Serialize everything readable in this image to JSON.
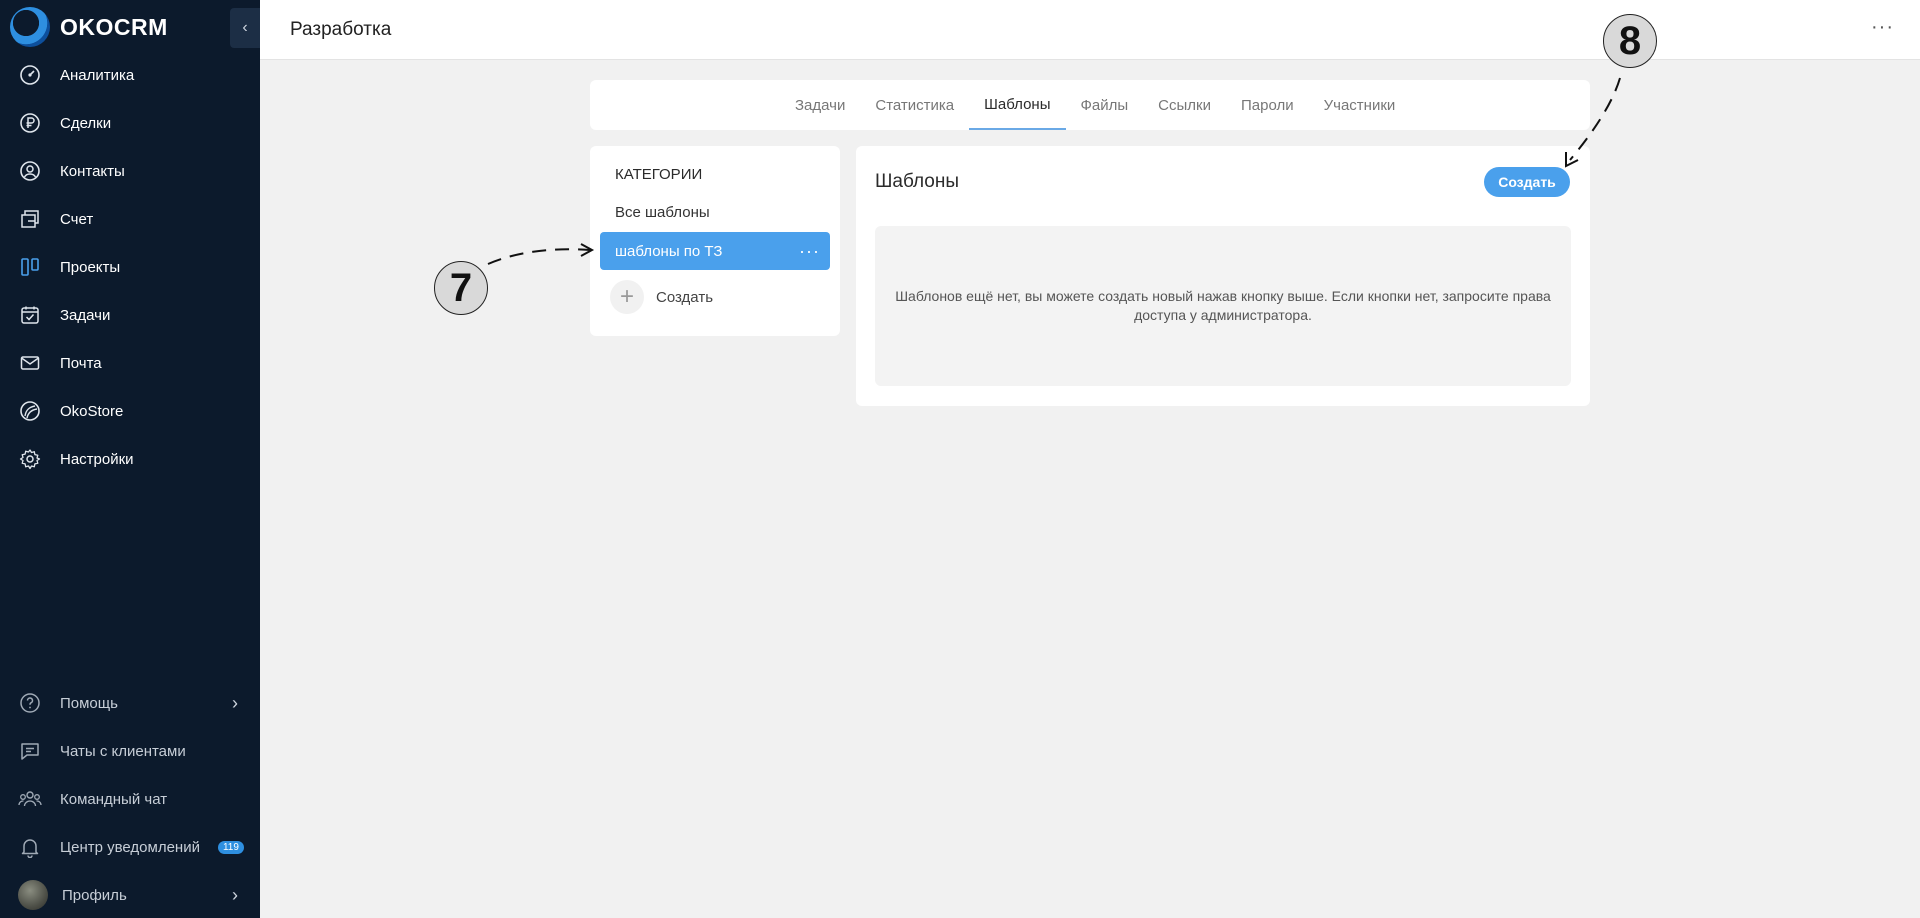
{
  "app": {
    "name": "OKOCRM"
  },
  "sidebar": {
    "items": [
      {
        "label": "Аналитика",
        "icon": "analytics-icon"
      },
      {
        "label": "Сделки",
        "icon": "ruble-icon"
      },
      {
        "label": "Контакты",
        "icon": "contact-icon"
      },
      {
        "label": "Счет",
        "icon": "invoice-icon"
      },
      {
        "label": "Проекты",
        "icon": "projects-icon"
      },
      {
        "label": "Задачи",
        "icon": "tasks-icon"
      },
      {
        "label": "Почта",
        "icon": "mail-icon"
      },
      {
        "label": "OkoStore",
        "icon": "store-icon"
      },
      {
        "label": "Настройки",
        "icon": "gear-icon"
      }
    ],
    "bottom": {
      "help": "Помощь",
      "client_chats": "Чаты с клиентами",
      "team_chat": "Командный чат",
      "notifications": "Центр уведомлений",
      "notifications_count": "119",
      "profile": "Профиль"
    },
    "active_color": "#4aa0ec"
  },
  "header": {
    "title": "Разработка"
  },
  "tabs": [
    {
      "label": "Задачи"
    },
    {
      "label": "Статистика"
    },
    {
      "label": "Шаблоны",
      "active": true
    },
    {
      "label": "Файлы"
    },
    {
      "label": "Ссылки"
    },
    {
      "label": "Пароли"
    },
    {
      "label": "Участники"
    }
  ],
  "categories": {
    "title": "КАТЕГОРИИ",
    "all": "Все шаблоны",
    "selected": "шаблоны по ТЗ",
    "create": "Создать"
  },
  "templates": {
    "title": "Шаблоны",
    "create_button": "Создать",
    "empty_text": "Шаблонов ещё нет, вы можете создать новый нажав кнопку выше. Если кнопки нет, запросите права доступа у администратора."
  },
  "annotations": {
    "first": "7",
    "second": "8"
  }
}
